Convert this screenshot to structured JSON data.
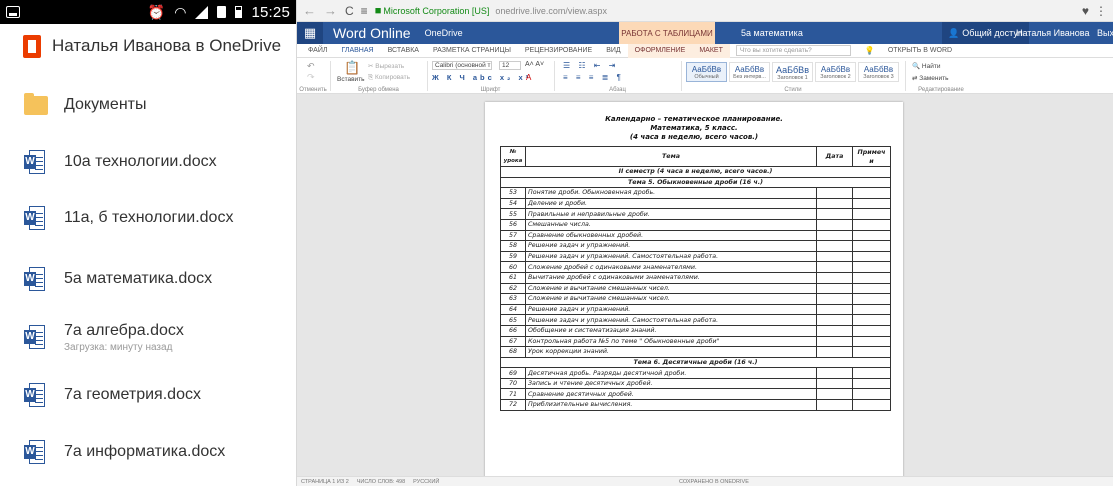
{
  "phone": {
    "status_time": "15:25",
    "title": "Наталья Иванова в OneDrive",
    "items": [
      {
        "type": "folder",
        "name": "Документы",
        "sub": ""
      },
      {
        "type": "word",
        "name": "10а технологии.docx",
        "sub": ""
      },
      {
        "type": "word",
        "name": "11а, б  технологии.docx",
        "sub": ""
      },
      {
        "type": "word",
        "name": "5а математика.docx",
        "sub": ""
      },
      {
        "type": "word",
        "name": "7а алгебра.docx",
        "sub": "Загрузка: минуту назад"
      },
      {
        "type": "word",
        "name": "7а геометрия.docx",
        "sub": ""
      },
      {
        "type": "word",
        "name": "7а информатика.docx",
        "sub": ""
      }
    ]
  },
  "browser": {
    "site": "Microsoft Corporation [US]",
    "url": "onedrive.live.com/view.aspx"
  },
  "word": {
    "app_name": "Word Online",
    "breadcrumb": "OneDrive",
    "context_tab_group": "РАБОТА С ТАБЛИЦАМИ",
    "doc_name": "5а математика",
    "share_label": "Общий доступ",
    "user_name": "Наталья Иванова",
    "exit_label": "Вых",
    "tabs": [
      "ФАЙЛ",
      "ГЛАВНАЯ",
      "ВСТАВКА",
      "РАЗМЕТКА СТРАНИЦЫ",
      "РЕЦЕНЗИРОВАНИЕ",
      "ВИД",
      "ОФОРМЛЕНИЕ",
      "МАКЕТ"
    ],
    "tellme_placeholder": "Что вы хотите сделать?",
    "open_in_word": "ОТКРЫТЬ В WORD",
    "ribbon": {
      "undo_group": "Отменить",
      "clipboard_group": "Буфер обмена",
      "paste": "Вставить",
      "cut": "Вырезать",
      "copy": "Копировать",
      "font_name": "Calibri (основной т",
      "font_size": "12",
      "font_group": "Шрифт",
      "paragraph_group": "Абзац",
      "styles_group": "Стили",
      "editing_group": "Редактирование",
      "find": "Найти",
      "replace": "Заменить",
      "styles": [
        {
          "sample": "АаБбВв",
          "name": "Обычный"
        },
        {
          "sample": "АаБбВв",
          "name": "Без интерв..."
        },
        {
          "sample": "АаБбВв",
          "name": "Заголовок 1"
        },
        {
          "sample": "АаБбВв",
          "name": "Заголовок 2"
        },
        {
          "sample": "АаБбВв",
          "name": "Заголовок 3"
        }
      ]
    },
    "document": {
      "title1": "Календарно – тематическое планирование.",
      "title2": "Математика, 5 класс.",
      "title3": "(4 часа в неделю, всего        часов.)",
      "headers": {
        "num": "№ урока",
        "topic": "Тема",
        "date": "Дата",
        "note": "Примеч и"
      },
      "rows": [
        {
          "sec": "II семестр (4 часа в неделю, всего      часов.)"
        },
        {
          "sec": "Тема 5. Обыкновенные дроби (16 ч.)"
        },
        {
          "n": "53",
          "t": "Понятие дроби. Обыкновенная дробь."
        },
        {
          "n": "54",
          "t": "Деление и дроби."
        },
        {
          "n": "55",
          "t": "Правильные и неправильные дроби."
        },
        {
          "n": "56",
          "t": "Смешанные числа."
        },
        {
          "n": "57",
          "t": "Сравнение обыкновенных дробей."
        },
        {
          "n": "58",
          "t": "Решение задач и упражнений."
        },
        {
          "n": "59",
          "t": "Решение задач и упражнений. Самостоятельная работа."
        },
        {
          "n": "60",
          "t": "Сложение дробей с одинаковыми знаменателями."
        },
        {
          "n": "61",
          "t": "Вычитание дробей с одинаковыми знаменателями."
        },
        {
          "n": "62",
          "t": "Сложение и вычитание смешанных чисел."
        },
        {
          "n": "63",
          "t": "Сложение и вычитание смешанных чисел."
        },
        {
          "n": "64",
          "t": "Решение задач и упражнений."
        },
        {
          "n": "65",
          "t": "Решение задач и упражнений. Самостоятельная работа."
        },
        {
          "n": "66",
          "t": "Обобщение и систематизация знаний."
        },
        {
          "n": "67",
          "t": "Контрольная работа №5 по теме \" Обыкновенные дроби\""
        },
        {
          "n": "68",
          "t": "Урок коррекции знаний."
        },
        {
          "sec": "Тема 6. Десятичные дроби (16 ч.)"
        },
        {
          "n": "69",
          "t": "Десятичная дробь. Разряды десятичной дроби."
        },
        {
          "n": "70",
          "t": "Запись и чтение десятичных дробей."
        },
        {
          "n": "71",
          "t": "Сравнение десятичных дробей."
        },
        {
          "n": "72",
          "t": "Приблизительные вычисления."
        }
      ]
    },
    "statusbar": {
      "page": "СТРАНИЦА 1 ИЗ 2",
      "words": "ЧИСЛО СЛОВ: 498",
      "lang": "РУССКИЙ",
      "saved": "СОХРАНЕНО В ONEDRIVE"
    }
  }
}
